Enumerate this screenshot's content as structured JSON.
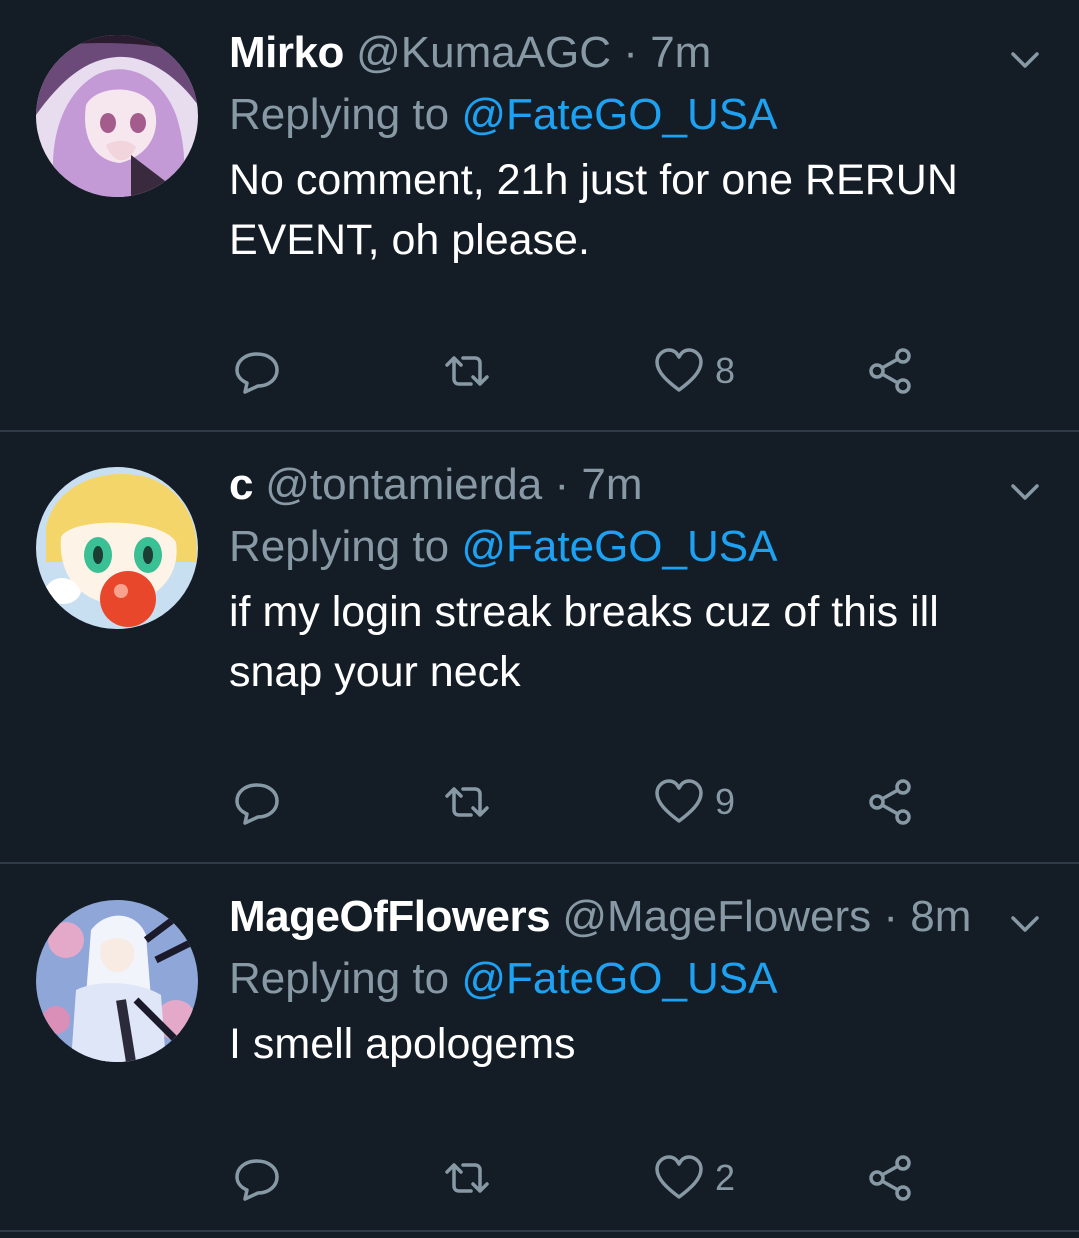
{
  "colors": {
    "background": "#141d26",
    "divider": "#2f3b47",
    "secondary_text": "#8899a6",
    "link": "#1da1f2"
  },
  "tweets": [
    {
      "name": "Mirko",
      "handle": "@KumaAGC",
      "dot": "·",
      "time": "7m",
      "replying_prefix": "Replying to",
      "replying_to": "@FateGO_USA",
      "text": "No comment, 21h just for one RERUN EVENT, oh please.",
      "likes": "8",
      "avatar_icon": "avatar-purple-haired-anime-girl"
    },
    {
      "name": "c",
      "handle": "@tontamierda",
      "dot": "·",
      "time": "7m",
      "replying_prefix": "Replying to",
      "replying_to": "@FateGO_USA",
      "text": "if my login streak breaks cuz of this ill snap your neck",
      "likes": "9",
      "avatar_icon": "avatar-blonde-anime-character-with-apple"
    },
    {
      "name": "MageOfFlowers",
      "handle": "@MageFlowers",
      "dot": "·",
      "time": "8m",
      "replying_prefix": "Replying to",
      "replying_to": "@FateGO_USA",
      "text": "I smell apologems",
      "likes": "2",
      "avatar_icon": "avatar-white-robed-mage"
    }
  ],
  "icons": {
    "reply": "reply-icon",
    "retweet": "retweet-icon",
    "like": "heart-icon",
    "share": "share-icon",
    "menu": "chevron-down-icon"
  }
}
